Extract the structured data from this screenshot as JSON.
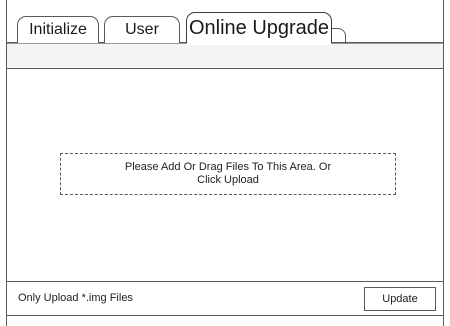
{
  "tabs": [
    {
      "label": "Initialize",
      "active": false
    },
    {
      "label": "User",
      "active": false
    },
    {
      "label": "Online Upgrade",
      "active": true
    }
  ],
  "dropzone": {
    "text": "Please Add Or Drag Files To This Area. Or Click Upload"
  },
  "footer": {
    "note": "Only Upload *.img Files",
    "update_label": "Update"
  }
}
